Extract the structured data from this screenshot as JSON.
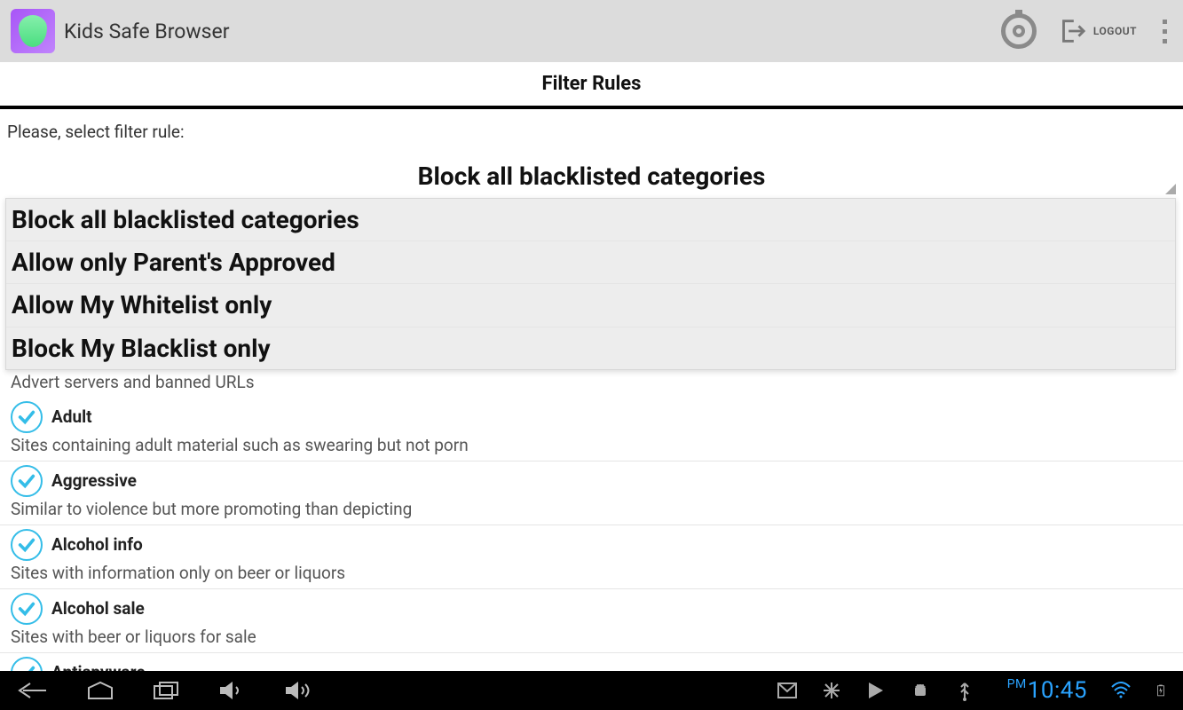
{
  "header": {
    "app_title": "Kids Safe Browser",
    "logout_label": "LOGOUT"
  },
  "page": {
    "section_title": "Filter Rules",
    "prompt": "Please, select filter rule:",
    "selected_rule": "Block all blacklisted categories"
  },
  "dropdown_options": [
    "Block all blacklisted categories",
    "Allow only Parent's Approved",
    "Allow My Whitelist only",
    "Block My Blacklist only"
  ],
  "partial_desc": "Advert servers and banned URLs",
  "categories": [
    {
      "title": "Adult",
      "desc": "Sites containing adult material such as swearing but not porn",
      "checked": true
    },
    {
      "title": "Aggressive",
      "desc": "Similar to violence but more promoting than depicting",
      "checked": true
    },
    {
      "title": "Alcohol info",
      "desc": "Sites with information only on beer or liquors",
      "checked": true
    },
    {
      "title": "Alcohol sale",
      "desc": "Sites with beer or liquors for sale",
      "checked": true
    },
    {
      "title": "Antispyware",
      "desc": "",
      "checked": true
    }
  ],
  "status_bar": {
    "time": "10:45",
    "ampm": "PM"
  }
}
